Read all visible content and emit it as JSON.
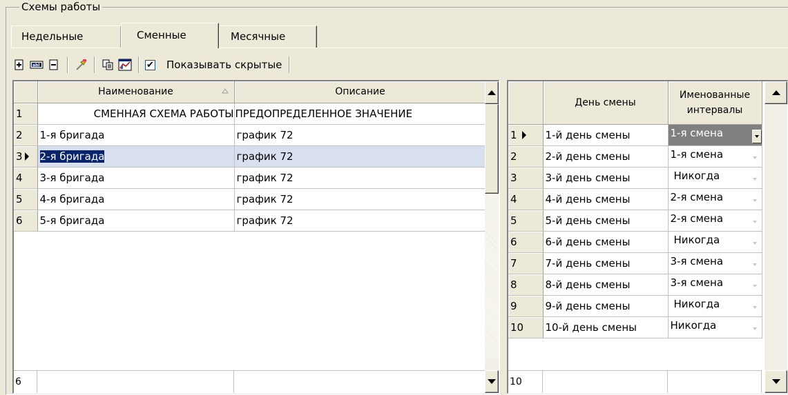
{
  "group": {
    "title": "Схемы работы"
  },
  "tabs": [
    {
      "label": "Недельные"
    },
    {
      "label": "Сменные"
    },
    {
      "label": "Месячные"
    }
  ],
  "toolbar": {
    "icons": [
      "add-icon",
      "rename-icon",
      "delete-icon",
      "properties-icon",
      "copy-icon",
      "chart-icon"
    ],
    "show_hidden_label": "Показывать скрытые",
    "show_hidden_checked": "✔"
  },
  "left_grid": {
    "headers": {
      "name": "Наименование",
      "description": "Описание"
    },
    "rows": [
      {
        "num": "1",
        "name": "СМЕННАЯ СХЕМА РАБОТЫ",
        "description": "ПРЕДОПРЕДЕЛЕННОЕ ЗНАЧЕНИЕ"
      },
      {
        "num": "2",
        "name": "1-я бригада",
        "description": "график 72"
      },
      {
        "num": "3",
        "name": "2-я бригада",
        "description": "график 72"
      },
      {
        "num": "4",
        "name": "3-я бригада",
        "description": "график 72"
      },
      {
        "num": "5",
        "name": "4-я бригада",
        "description": "график 72"
      },
      {
        "num": "6",
        "name": "5-я бригада",
        "description": "график 72"
      }
    ],
    "footer_count": "6"
  },
  "right_grid": {
    "headers": {
      "day": "День смены",
      "intervals": "Именованные интервалы"
    },
    "rows": [
      {
        "num": "1",
        "day": "1-й день смены",
        "interval": "1-я смена"
      },
      {
        "num": "2",
        "day": "2-й день смены",
        "interval": "1-я смена"
      },
      {
        "num": "3",
        "day": "3-й день смены",
        "interval": "Никогда"
      },
      {
        "num": "4",
        "day": "4-й день смены",
        "interval": "2-я смена"
      },
      {
        "num": "5",
        "day": "5-й день смены",
        "interval": "2-я смена"
      },
      {
        "num": "6",
        "day": "6-й день смены",
        "interval": "Никогда"
      },
      {
        "num": "7",
        "day": "7-й день смены",
        "interval": "3-я смена"
      },
      {
        "num": "8",
        "day": "8-й день смены",
        "interval": "3-я смена"
      },
      {
        "num": "9",
        "day": "9-й день смены",
        "interval": "Никогда"
      },
      {
        "num": "10",
        "day": "10-й день смены",
        "interval": "Никогда"
      }
    ],
    "footer_count": "10"
  },
  "colors": {
    "selection": "#0a246a",
    "selected_row": "#d8dfee",
    "face": "#ece9d8"
  }
}
